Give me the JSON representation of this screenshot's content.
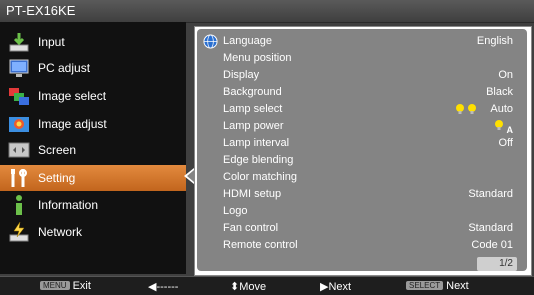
{
  "window": {
    "title": "PT-EX16KE"
  },
  "menu": {
    "items": [
      {
        "label": "Input",
        "icon": "input-icon"
      },
      {
        "label": "PC adjust",
        "icon": "pc-adjust-icon"
      },
      {
        "label": "Image select",
        "icon": "image-select-icon"
      },
      {
        "label": "Image adjust",
        "icon": "image-adjust-icon"
      },
      {
        "label": "Screen",
        "icon": "screen-icon"
      },
      {
        "label": "Setting",
        "icon": "setting-icon",
        "active": true
      },
      {
        "label": "Information",
        "icon": "information-icon"
      },
      {
        "label": "Network",
        "icon": "network-icon"
      }
    ]
  },
  "settings": {
    "rows": [
      {
        "label": "Language",
        "value": "English"
      },
      {
        "label": "Menu position",
        "value": ""
      },
      {
        "label": "Display",
        "value": "On"
      },
      {
        "label": "Background",
        "value": "Black"
      },
      {
        "label": "Lamp select",
        "value": "Auto"
      },
      {
        "label": "Lamp power",
        "value": "A"
      },
      {
        "label": "Lamp interval",
        "value": "Off"
      },
      {
        "label": "Edge blending",
        "value": ""
      },
      {
        "label": "Color matching",
        "value": ""
      },
      {
        "label": "HDMI setup",
        "value": "Standard"
      },
      {
        "label": "Logo",
        "value": ""
      },
      {
        "label": "Fan control",
        "value": "Standard"
      },
      {
        "label": "Remote control",
        "value": "Code 01"
      }
    ],
    "page_indicator": "1/2"
  },
  "footer": {
    "exit_key": "MENU",
    "exit_label": "Exit",
    "back_label": "------",
    "move_label": "Move",
    "next_label": "Next",
    "select_key": "SELECT",
    "select_label": "Next"
  },
  "colors": {
    "active_item": "#d4772b",
    "panel_bg": "#848484",
    "menu_bg": "#111111"
  }
}
